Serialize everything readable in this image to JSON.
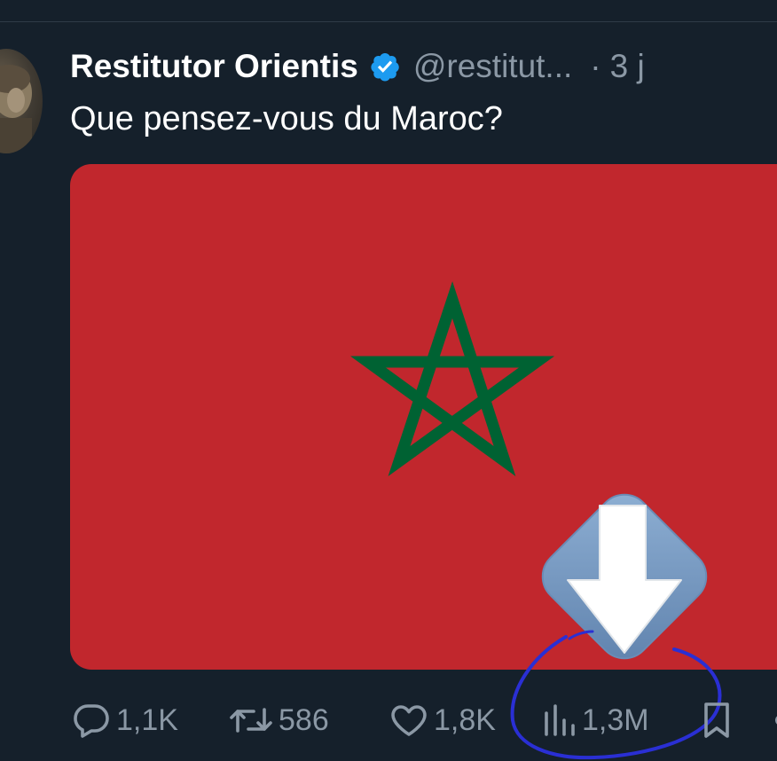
{
  "tweet": {
    "author_name": "Restitutor Orientis",
    "handle": "@restitut...",
    "separator": "·",
    "time": "3 j",
    "text": "Que pensez-vous du Maroc?",
    "verified": true,
    "verified_color": "#1d9bf0"
  },
  "media": {
    "flag": "Morocco",
    "background_color": "#c1272d",
    "star_color": "#006233"
  },
  "overlay": {
    "icon": "downvote-arrow-icon",
    "scribble_color": "#2a2fd4"
  },
  "actions": {
    "replies": "1,1K",
    "retweets": "586",
    "likes": "1,8K",
    "views": "1,3M"
  },
  "colors": {
    "background": "#15202b",
    "text_primary": "#ffffff",
    "text_secondary": "#8b98a5"
  }
}
